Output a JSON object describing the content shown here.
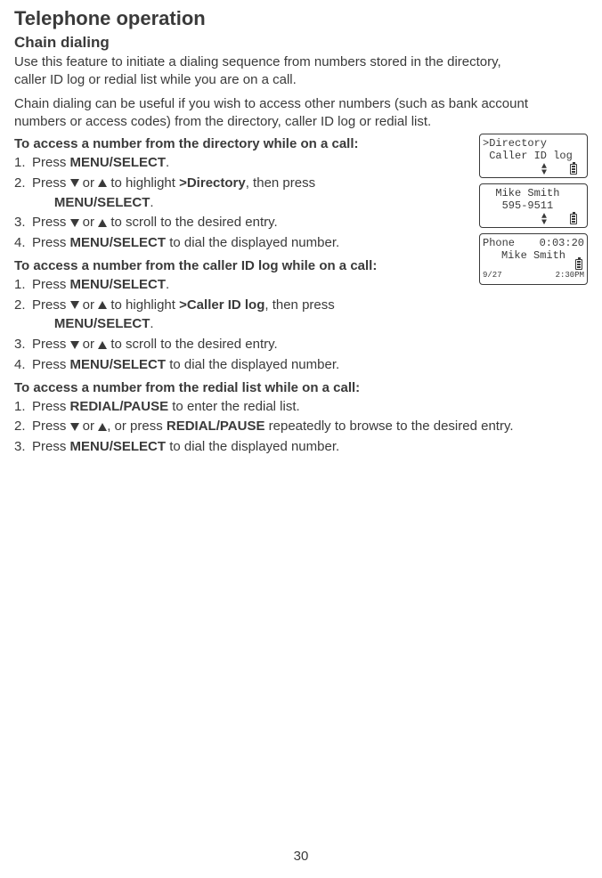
{
  "title": "Telephone operation",
  "section": "Chain dialing",
  "intro1": "Use this feature to initiate a dialing sequence from numbers stored in the directory, caller ID log or redial list while you are on a call.",
  "intro2": "Chain dialing can be useful if you wish to access other numbers (such as bank account numbers or access codes) from the directory, caller ID log or redial list.",
  "proc1": {
    "title": "To access a number from the directory while on a call:",
    "steps": [
      {
        "n": "1.",
        "pre": "Press ",
        "b1": "MENU/",
        "b2": "SELECT",
        "post": "."
      },
      {
        "n": "2.",
        "line": "navDirectory"
      },
      {
        "n": "3.",
        "line": "scrollEntry"
      },
      {
        "n": "4.",
        "line": "dialDisplayed"
      }
    ]
  },
  "proc2": {
    "title": "To access a number from the caller ID log while on a call:",
    "steps": [
      {
        "n": "1.",
        "pre": "Press ",
        "b1": "MENU/",
        "b2": "SELECT",
        "post": "."
      },
      {
        "n": "2.",
        "line": "navCallerID"
      },
      {
        "n": "3.",
        "line": "scrollEntry"
      },
      {
        "n": "4.",
        "line": "dialDisplayed"
      }
    ]
  },
  "proc3": {
    "title": "To access a number from the redial list while on a call:",
    "steps": [
      {
        "n": "1.",
        "line": "redialEnter"
      },
      {
        "n": "2.",
        "line": "redialBrowse"
      },
      {
        "n": "3.",
        "line": "dialDisplayed"
      }
    ]
  },
  "frag": {
    "press": "Press ",
    "or": " or ",
    "toHighlight": " to highlight ",
    "thenPress": ", then press ",
    "menu": "MENU",
    "select": "/SELECT",
    "dot": ".",
    "gtDirectory": ">Directory",
    "gtCallerID": ">Caller ID log",
    "scrollDesired": " to scroll to the desired entry.",
    "dialDisplayed": " to dial the displayed number.",
    "redialPause": "REDIAL/",
    "pause": "PAUSE",
    "enterRedial": " to enter the redial list.",
    "commaOrPress": ", or press ",
    "browseDesired": " repeatedly to browse to the desired entry."
  },
  "screens": {
    "s1": {
      "l1": ">Directory",
      "l2": " Caller ID log"
    },
    "s2": {
      "l1": "  Mike Smith",
      "l2": "   595-9511"
    },
    "s3": {
      "l1a": "Phone",
      "l1b": "0:03:20",
      "l2": "Mike Smith",
      "bl": "9/27",
      "br": "2:30PM"
    }
  },
  "page": "30"
}
